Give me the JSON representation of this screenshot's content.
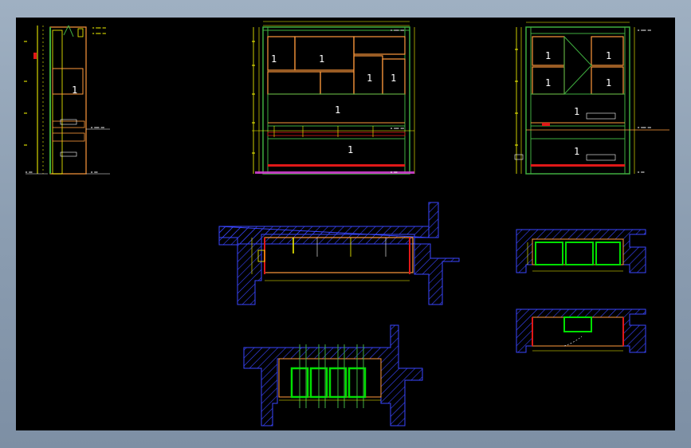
{
  "colors": {
    "frame_gray": "#8a9cb0",
    "canvas": "#000000",
    "cabinet_orange": "#ff9a3c",
    "wall_green": "#3fae3f",
    "dim_yellow": "#ffff00",
    "hatch_blue": "#3a46ff",
    "glass_green": "#00e000",
    "base_red": "#e01818",
    "accent_magenta": "#d040d0"
  },
  "labels": {
    "panel_number": "1"
  }
}
